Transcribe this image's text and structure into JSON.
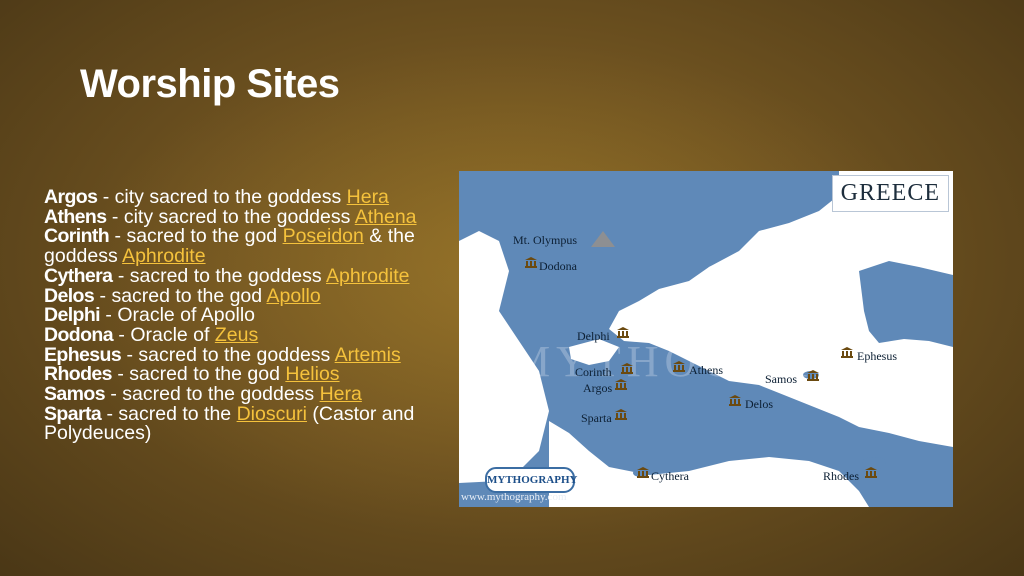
{
  "slide": {
    "title": "Worship Sites"
  },
  "sites": [
    {
      "name": "Argos",
      "pre": " - city sacred to the goddess ",
      "link": "Hera",
      "post": ""
    },
    {
      "name": "Athens",
      "pre": " - city sacred to the goddess ",
      "link": "Athena",
      "post": ""
    },
    {
      "name": "Corinth",
      "pre": " - sacred to the god ",
      "link": "Poseidon",
      "post": " & the goddess ",
      "link2": "Aphrodite"
    },
    {
      "name": "Cythera",
      "pre": " - sacred to the goddess ",
      "link": "Aphrodite",
      "post": ""
    },
    {
      "name": "Delos",
      "pre": " - sacred to the god ",
      "link": "Apollo",
      "post": ""
    },
    {
      "name": "Delphi",
      "pre": " - Oracle of Apollo",
      "link": "",
      "post": ""
    },
    {
      "name": "Dodona",
      "pre": " - Oracle of ",
      "link": "Zeus",
      "post": ""
    },
    {
      "name": "Ephesus",
      "pre": " - sacred to the goddess ",
      "link": "Artemis",
      "post": ""
    },
    {
      "name": "Rhodes",
      "pre": " - sacred to the god ",
      "link": "Helios",
      "post": ""
    },
    {
      "name": "Samos",
      "pre": " - sacred to the goddess ",
      "link": "Hera",
      "post": ""
    },
    {
      "name": "Sparta",
      "pre": " - sacred to the ",
      "link": "Dioscuri",
      "post": " (Castor and Polydeuces)"
    }
  ],
  "map": {
    "heading": "GREECE",
    "watermark": "MYTHOGRAPHY",
    "logo": "MYTHOGRAPHY",
    "url": "www.mythography.com",
    "labels": {
      "olympus": "Mt. Olympus",
      "dodona": "Dodona",
      "delphi": "Delphi",
      "corinth": "Corinth",
      "argos": "Argos",
      "athens": "Athens",
      "sparta": "Sparta",
      "delos": "Delos",
      "samos": "Samos",
      "ephesus": "Ephesus",
      "cythera": "Cythera",
      "rhodes": "Rhodes"
    },
    "colors": {
      "sea": "#ffffff",
      "land": "#5f89b8",
      "land_dark": "#4f78a7"
    }
  }
}
